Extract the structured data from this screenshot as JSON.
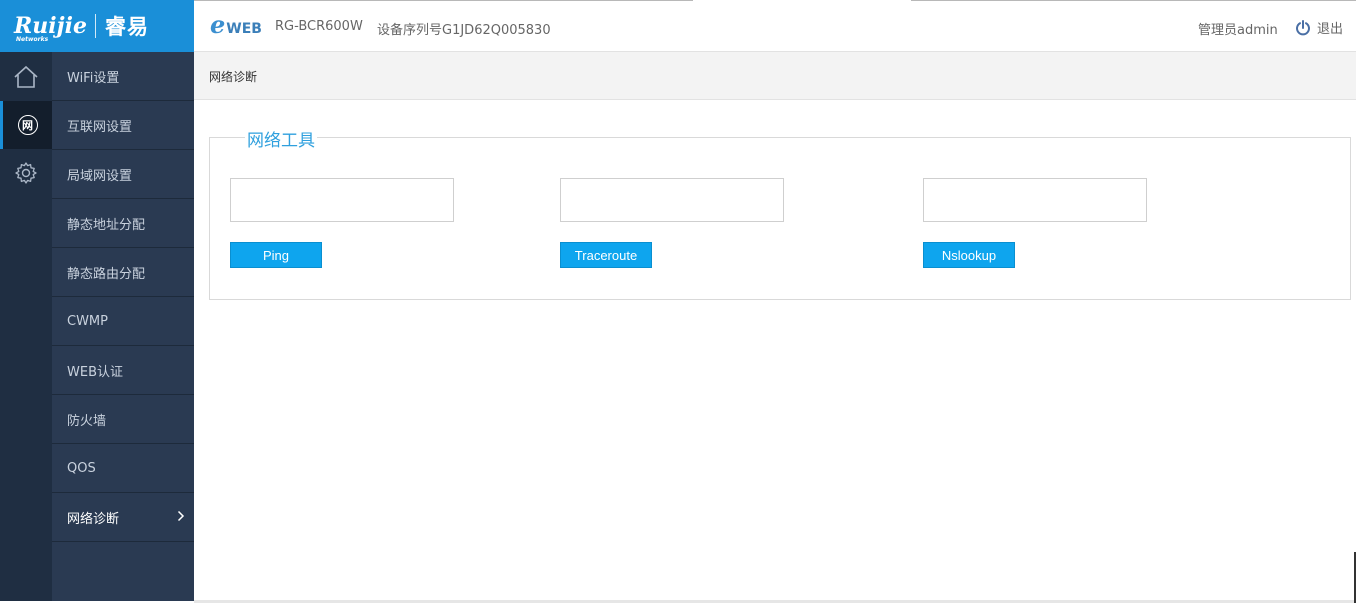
{
  "header": {
    "brand_en": "Ruijie",
    "brand_sub": "Networks",
    "brand_cn": "睿易",
    "eweb_e": "e",
    "eweb_text": "WEB",
    "model": "RG-BCR600W",
    "serial": "设备序列号G1JD62Q005830",
    "admin": "管理员admin",
    "logout": "退出"
  },
  "icon_nav": [
    {
      "icon": "home-icon"
    },
    {
      "icon": "network-icon",
      "glyph": "网",
      "active": true
    },
    {
      "icon": "gear-icon"
    }
  ],
  "menu": {
    "items": [
      {
        "label": "WiFi设置"
      },
      {
        "label": "互联网设置"
      },
      {
        "label": "局域网设置"
      },
      {
        "label": "静态地址分配"
      },
      {
        "label": "静态路由分配"
      },
      {
        "label": "CWMP"
      },
      {
        "label": "WEB认证"
      },
      {
        "label": "防火墙"
      },
      {
        "label": "QOS"
      },
      {
        "label": "网络诊断",
        "active": true
      }
    ]
  },
  "breadcrumb": "网络诊断",
  "tools": {
    "legend": "网络工具",
    "items": [
      {
        "input_value": "",
        "button": "Ping"
      },
      {
        "input_value": "",
        "button": "Traceroute"
      },
      {
        "input_value": "",
        "button": "Nslookup"
      }
    ]
  },
  "colors": {
    "brand": "#1a8fd8",
    "button": "#0ea5ee",
    "sidebar_dark": "#1f2e42",
    "sidebar_menu": "#2a3a52"
  }
}
